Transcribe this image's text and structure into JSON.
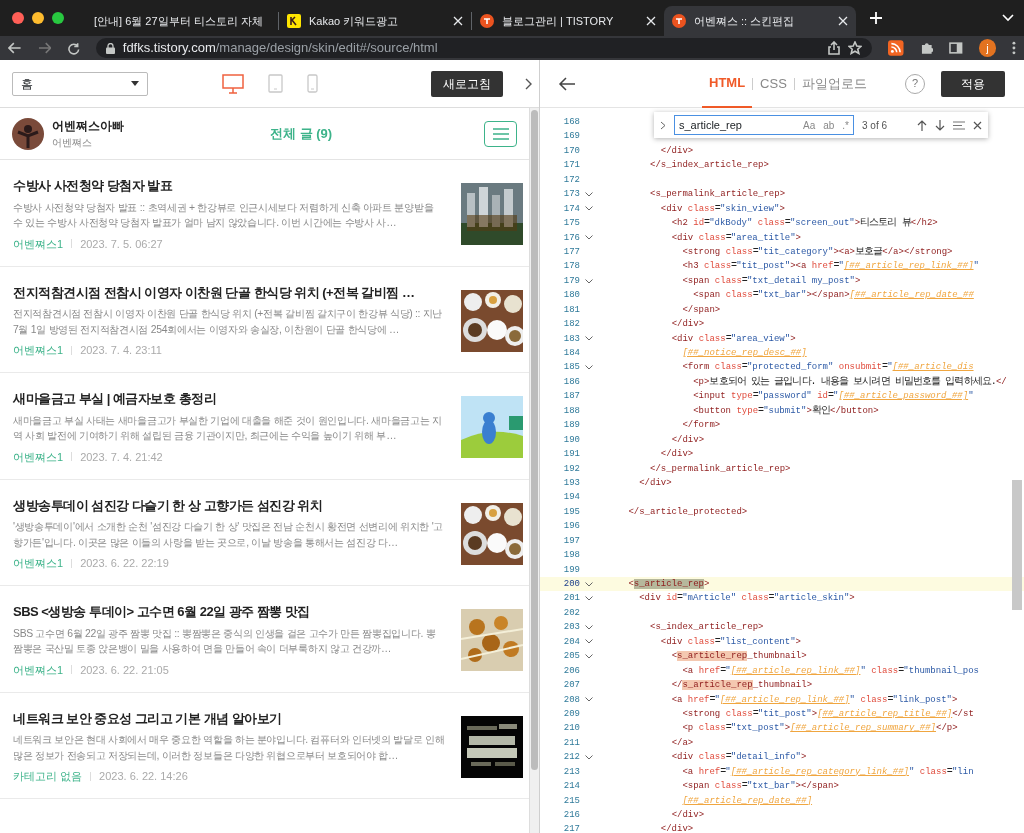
{
  "browser": {
    "tabs": [
      {
        "title": "[안내] 6월 27일부터 티스토리 자체",
        "kind": "none",
        "selected": false
      },
      {
        "title": "Kakao 키워드광고",
        "kind": "kakao",
        "selected": false
      },
      {
        "title": "블로그관리 | TISTORY",
        "kind": "tistory",
        "selected": false
      },
      {
        "title": "어벤쪄스 :: 스킨편집",
        "kind": "tistory",
        "selected": true
      }
    ],
    "url": {
      "host": "fdfks.tistory.com",
      "path": "/manage/design/skin/edit#/source/html"
    },
    "profile_initial": "j"
  },
  "preview": {
    "page_select": "홈",
    "devices": [
      {
        "kind": "desktop",
        "selected": true
      },
      {
        "kind": "tablet",
        "selected": false
      },
      {
        "kind": "mobile",
        "selected": false
      }
    ],
    "refresh_button": "새로고침",
    "blog": {
      "name": "어벤쪄스아빠",
      "subtitle": "어벤쪄스",
      "total": "전체 글 (9)"
    },
    "posts": [
      {
        "title": "수방사 사전청약 당첨자 발표",
        "summary": "수방사 사전청약 당첨자 발표 :: 초역세권 + 한강뷰로 인근시세보다 저렴하게 신축 아파트 분양받을 수 있는 수방사 사전청약 당첨자 발표가 얼마 남지 않았습니다. 이번 시간에는 수방사 사…",
        "category": "어벤쪄스1",
        "date": "2023. 7. 5. 06:27"
      },
      {
        "title": "전지적참견시점 전참시 이영자 이찬원 단골 한식당 위치 (+전복 갈비찜 …",
        "summary": "전지적참견시점 전참시 이영자 이찬원 단골 한식당 위치 (+전복 갈비찜 갈치구이 한강뷰 식당) :: 지난 7월 1일 방영된 전지적참견시점 254회에서는 이영자와 송실장, 이찬원이 단골 한식당에 …",
        "category": "어벤쪄스1",
        "date": "2023. 7. 4. 23:11"
      },
      {
        "title": "새마을금고 부실 | 예금자보호 총정리",
        "summary": "새마을금고 부실 사태는 새마을금고가 부실한 기업에 대출을 해준 것이 원인입니다. 새마을금고는 지역 사회 발전에 기여하기 위해 설립된 금융 기관이지만, 최근에는 수익을 높이기 위해 부…",
        "category": "어벤쪄스1",
        "date": "2023. 7. 4. 21:42"
      },
      {
        "title": "생방송투데이 섬진강 다슬기 한 상 고향가든 섬진강 위치",
        "summary": "'생방송투데이'에서 소개한 순천 '섬진강 다슬기 한 상' 맛집은 전남 순천시 황전면 선변리에 위치한 '고향가든'입니다. 이곳은 많은 이들의 사랑을 받는 곳으로, 이날 방송을 통해서는 섬진강 다…",
        "category": "어벤쪄스1",
        "date": "2023. 6. 22. 22:19"
      },
      {
        "title": "SBS <생방송 투데이> 고수면 6월 22일 광주 짬뽕 맛집",
        "summary": "SBS 고수면 6월 22일 광주 짬뽕 맛집 :: 뽕짬뽕은 중식의 인생을 걸은 고수가 만든 짬뽕집입니다. 뽕짬뽕은 국산밀 토종 앉은뱅이 밀을 사용하여 면을 만들어 속이 더부룩하지 않고 건강까…",
        "category": "어벤쪄스1",
        "date": "2023. 6. 22. 21:05"
      },
      {
        "title": "네트워크 보안 중요성 그리고 기본 개념 알아보기",
        "summary": "네트워크 보안은 현대 사회에서 매우 중요한 역할을 하는 분야입니다. 컴퓨터와 인터넷의 발달로 인해 많은 정보가 전송되고 저장되는데, 이러한 정보들은 다양한 위협으로부터 보호되어야 합…",
        "category": "카테고리 없음",
        "date": "2023. 6. 22. 14:26"
      }
    ]
  },
  "editor": {
    "tabs": [
      {
        "label": "HTML",
        "selected": true
      },
      {
        "label": "CSS",
        "selected": false
      },
      {
        "label": "파일업로드",
        "selected": false
      }
    ],
    "help": "?",
    "apply_button": "적용",
    "find": {
      "value": "s_article_rep",
      "options": [
        "Aa",
        "ab",
        ".*"
      ],
      "count": "3 of 6"
    },
    "lines": [
      {
        "number": "168",
        "fold": false,
        "current": false
      },
      {
        "number": "169",
        "fold": false,
        "current": false
      },
      {
        "number": "170",
        "fold": false,
        "current": false,
        "tokens": [
          {
            "kind": "tag",
            "text": "            </div>"
          }
        ]
      },
      {
        "number": "171",
        "fold": false,
        "current": false,
        "tokens": [
          {
            "kind": "tag",
            "text": "          </s_index_article_rep>"
          }
        ]
      },
      {
        "number": "172",
        "fold": false,
        "current": false
      },
      {
        "number": "173",
        "fold": true,
        "current": false,
        "tokens": [
          {
            "kind": "tag",
            "text": "          <s_permalink_article_rep>"
          }
        ]
      },
      {
        "number": "174",
        "fold": true,
        "current": false,
        "tokens": [
          {
            "kind": "tag",
            "text": "            <div"
          },
          {
            "kind": "attr",
            "text": " class"
          },
          {
            "kind": "text",
            "text": "="
          },
          {
            "kind": "string",
            "text": "\"skin_view\""
          },
          {
            "kind": "tag",
            "text": ">"
          }
        ]
      },
      {
        "number": "175",
        "fold": false,
        "current": false,
        "tokens": [
          {
            "kind": "tag",
            "text": "              <h2"
          },
          {
            "kind": "attr",
            "text": " id"
          },
          {
            "kind": "text",
            "text": "="
          },
          {
            "kind": "string",
            "text": "\"dkBody\""
          },
          {
            "kind": "attr",
            "text": " class"
          },
          {
            "kind": "text",
            "text": "="
          },
          {
            "kind": "string",
            "text": "\"screen_out\""
          },
          {
            "kind": "tag",
            "text": ">"
          },
          {
            "kind": "text",
            "text": "티스토리 뷰"
          },
          {
            "kind": "tag",
            "text": "</h2>"
          }
        ]
      },
      {
        "number": "176",
        "fold": true,
        "current": false,
        "tokens": [
          {
            "kind": "tag",
            "text": "              <div"
          },
          {
            "kind": "attr",
            "text": " class"
          },
          {
            "kind": "text",
            "text": "="
          },
          {
            "kind": "string",
            "text": "\"area_title\""
          },
          {
            "kind": "tag",
            "text": ">"
          }
        ]
      },
      {
        "number": "177",
        "fold": false,
        "current": false,
        "tokens": [
          {
            "kind": "tag",
            "text": "                <strong"
          },
          {
            "kind": "attr",
            "text": " class"
          },
          {
            "kind": "text",
            "text": "="
          },
          {
            "kind": "string",
            "text": "\"tit_category\""
          },
          {
            "kind": "tag",
            "text": "><a>"
          },
          {
            "kind": "text",
            "text": "보호글"
          },
          {
            "kind": "tag",
            "text": "</a></strong>"
          }
        ]
      },
      {
        "number": "178",
        "fold": false,
        "current": false,
        "tokens": [
          {
            "kind": "tag",
            "text": "                <h3"
          },
          {
            "kind": "attr",
            "text": " class"
          },
          {
            "kind": "text",
            "text": "="
          },
          {
            "kind": "string",
            "text": "\"tit_post\""
          },
          {
            "kind": "tag",
            "text": "><a"
          },
          {
            "kind": "attr",
            "text": " href"
          },
          {
            "kind": "text",
            "text": "="
          },
          {
            "kind": "string",
            "text": "\""
          },
          {
            "kind": "template",
            "text": "[##_article_rep_link_##]"
          },
          {
            "kind": "string",
            "text": "\""
          }
        ]
      },
      {
        "number": "179",
        "fold": true,
        "current": false,
        "tokens": [
          {
            "kind": "tag",
            "text": "                <span"
          },
          {
            "kind": "attr",
            "text": " class"
          },
          {
            "kind": "text",
            "text": "="
          },
          {
            "kind": "string",
            "text": "\"txt_detail my_post\""
          },
          {
            "kind": "tag",
            "text": ">"
          }
        ]
      },
      {
        "number": "180",
        "fold": false,
        "current": false,
        "tokens": [
          {
            "kind": "tag",
            "text": "                  <span"
          },
          {
            "kind": "attr",
            "text": " class"
          },
          {
            "kind": "text",
            "text": "="
          },
          {
            "kind": "string",
            "text": "\"txt_bar\""
          },
          {
            "kind": "tag",
            "text": "></span>"
          },
          {
            "kind": "template",
            "text": "[##_article_rep_date_##"
          }
        ]
      },
      {
        "number": "181",
        "fold": false,
        "current": false,
        "tokens": [
          {
            "kind": "tag",
            "text": "                </span>"
          }
        ]
      },
      {
        "number": "182",
        "fold": false,
        "current": false,
        "tokens": [
          {
            "kind": "tag",
            "text": "              </div>"
          }
        ]
      },
      {
        "number": "183",
        "fold": true,
        "current": false,
        "tokens": [
          {
            "kind": "tag",
            "text": "              <div"
          },
          {
            "kind": "attr",
            "text": " class"
          },
          {
            "kind": "text",
            "text": "="
          },
          {
            "kind": "string",
            "text": "\"area_view\""
          },
          {
            "kind": "tag",
            "text": ">"
          }
        ]
      },
      {
        "number": "184",
        "fold": false,
        "current": false,
        "tokens": [
          {
            "kind": "template",
            "text": "                [##_notice_rep_desc_##]"
          }
        ]
      },
      {
        "number": "185",
        "fold": true,
        "current": false,
        "tokens": [
          {
            "kind": "tag",
            "text": "                <form"
          },
          {
            "kind": "attr",
            "text": " class"
          },
          {
            "kind": "text",
            "text": "="
          },
          {
            "kind": "string",
            "text": "\"protected_form\""
          },
          {
            "kind": "attr",
            "text": " onsubmit"
          },
          {
            "kind": "text",
            "text": "="
          },
          {
            "kind": "string",
            "text": "\""
          },
          {
            "kind": "template",
            "text": "[##_article_dis"
          }
        ]
      },
      {
        "number": "186",
        "fold": false,
        "current": false,
        "tokens": [
          {
            "kind": "tag",
            "text": "                  <p>"
          },
          {
            "kind": "text",
            "text": "보호되어 있는 글입니다. 내용을 보시려면 비밀번호를 입력하세요."
          },
          {
            "kind": "tag",
            "text": "</"
          }
        ]
      },
      {
        "number": "187",
        "fold": false,
        "current": false,
        "tokens": [
          {
            "kind": "tag",
            "text": "                  <input"
          },
          {
            "kind": "attr",
            "text": " type"
          },
          {
            "kind": "text",
            "text": "="
          },
          {
            "kind": "string",
            "text": "\"password\""
          },
          {
            "kind": "attr",
            "text": " id"
          },
          {
            "kind": "text",
            "text": "="
          },
          {
            "kind": "string",
            "text": "\""
          },
          {
            "kind": "template",
            "text": "[##_article_password_##]"
          },
          {
            "kind": "string",
            "text": "\""
          }
        ]
      },
      {
        "number": "188",
        "fold": false,
        "current": false,
        "tokens": [
          {
            "kind": "tag",
            "text": "                  <button"
          },
          {
            "kind": "attr",
            "text": " type"
          },
          {
            "kind": "text",
            "text": "="
          },
          {
            "kind": "string",
            "text": "\"submit\""
          },
          {
            "kind": "tag",
            "text": ">"
          },
          {
            "kind": "text",
            "text": "확인"
          },
          {
            "kind": "tag",
            "text": "</button>"
          }
        ]
      },
      {
        "number": "189",
        "fold": false,
        "current": false,
        "tokens": [
          {
            "kind": "tag",
            "text": "                </form>"
          }
        ]
      },
      {
        "number": "190",
        "fold": false,
        "current": false,
        "tokens": [
          {
            "kind": "tag",
            "text": "              </div>"
          }
        ]
      },
      {
        "number": "191",
        "fold": false,
        "current": false,
        "tokens": [
          {
            "kind": "tag",
            "text": "            </div>"
          }
        ]
      },
      {
        "number": "192",
        "fold": false,
        "current": false,
        "tokens": [
          {
            "kind": "tag",
            "text": "          </s_permalink_article_rep>"
          }
        ]
      },
      {
        "number": "193",
        "fold": false,
        "current": false,
        "tokens": [
          {
            "kind": "tag",
            "text": "        </div>"
          }
        ]
      },
      {
        "number": "194",
        "fold": false,
        "current": false
      },
      {
        "number": "195",
        "fold": false,
        "current": false,
        "tokens": [
          {
            "kind": "tag",
            "text": "      </s_article_protected>"
          }
        ]
      },
      {
        "number": "196",
        "fold": false,
        "current": false
      },
      {
        "number": "197",
        "fold": false,
        "current": false
      },
      {
        "number": "198",
        "fold": false,
        "current": false
      },
      {
        "number": "199",
        "fold": false,
        "current": false
      },
      {
        "number": "200",
        "fold": true,
        "current": true,
        "tokens": [
          {
            "kind": "tag",
            "text": "      <"
          },
          {
            "kind": "current_match",
            "text": "s_article_rep"
          },
          {
            "kind": "tag",
            "text": ">"
          }
        ]
      },
      {
        "number": "201",
        "fold": true,
        "current": false,
        "tokens": [
          {
            "kind": "tag",
            "text": "        <div"
          },
          {
            "kind": "attr",
            "text": " id"
          },
          {
            "kind": "text",
            "text": "="
          },
          {
            "kind": "string",
            "text": "\"mArticle\""
          },
          {
            "kind": "attr",
            "text": " class"
          },
          {
            "kind": "text",
            "text": "="
          },
          {
            "kind": "string",
            "text": "\"article_skin\""
          },
          {
            "kind": "tag",
            "text": ">"
          }
        ]
      },
      {
        "number": "202",
        "fold": false,
        "current": false
      },
      {
        "number": "203",
        "fold": true,
        "current": false,
        "tokens": [
          {
            "kind": "tag",
            "text": "          <s_index_article_rep>"
          }
        ]
      },
      {
        "number": "204",
        "fold": true,
        "current": false,
        "tokens": [
          {
            "kind": "tag",
            "text": "            <div"
          },
          {
            "kind": "attr",
            "text": " class"
          },
          {
            "kind": "text",
            "text": "="
          },
          {
            "kind": "string",
            "text": "\"list_content\""
          },
          {
            "kind": "tag",
            "text": ">"
          }
        ]
      },
      {
        "number": "205",
        "fold": true,
        "current": false,
        "tokens": [
          {
            "kind": "tag",
            "text": "              <"
          },
          {
            "kind": "match",
            "text": "s_article_rep"
          },
          {
            "kind": "tag",
            "text": "_thumbnail>"
          }
        ]
      },
      {
        "number": "206",
        "fold": false,
        "current": false,
        "tokens": [
          {
            "kind": "tag",
            "text": "                <a"
          },
          {
            "kind": "attr",
            "text": " href"
          },
          {
            "kind": "text",
            "text": "="
          },
          {
            "kind": "string",
            "text": "\""
          },
          {
            "kind": "template",
            "text": "[##_article_rep_link_##]"
          },
          {
            "kind": "string",
            "text": "\""
          },
          {
            "kind": "attr",
            "text": " class"
          },
          {
            "kind": "text",
            "text": "="
          },
          {
            "kind": "string",
            "text": "\"thumbnail_pos"
          }
        ]
      },
      {
        "number": "207",
        "fold": false,
        "current": false,
        "tokens": [
          {
            "kind": "tag",
            "text": "              </"
          },
          {
            "kind": "match",
            "text": "s_article_rep"
          },
          {
            "kind": "tag",
            "text": "_thumbnail>"
          }
        ]
      },
      {
        "number": "208",
        "fold": true,
        "current": false,
        "tokens": [
          {
            "kind": "tag",
            "text": "              <a"
          },
          {
            "kind": "attr",
            "text": " href"
          },
          {
            "kind": "text",
            "text": "="
          },
          {
            "kind": "string",
            "text": "\""
          },
          {
            "kind": "template",
            "text": "[##_article_rep_link_##]"
          },
          {
            "kind": "string",
            "text": "\""
          },
          {
            "kind": "attr",
            "text": " class"
          },
          {
            "kind": "text",
            "text": "="
          },
          {
            "kind": "string",
            "text": "\"link_post\""
          },
          {
            "kind": "tag",
            "text": ">"
          }
        ]
      },
      {
        "number": "209",
        "fold": false,
        "current": false,
        "tokens": [
          {
            "kind": "tag",
            "text": "                <strong"
          },
          {
            "kind": "attr",
            "text": " class"
          },
          {
            "kind": "text",
            "text": "="
          },
          {
            "kind": "string",
            "text": "\"tit_post\""
          },
          {
            "kind": "tag",
            "text": ">"
          },
          {
            "kind": "template",
            "text": "[##_article_rep_title_##]"
          },
          {
            "kind": "tag",
            "text": "</st"
          }
        ]
      },
      {
        "number": "210",
        "fold": false,
        "current": false,
        "tokens": [
          {
            "kind": "tag",
            "text": "                <p"
          },
          {
            "kind": "attr",
            "text": " class"
          },
          {
            "kind": "text",
            "text": "="
          },
          {
            "kind": "string",
            "text": "\"txt_post\""
          },
          {
            "kind": "tag",
            "text": ">"
          },
          {
            "kind": "template",
            "text": "[##_article_rep_summary_##]"
          },
          {
            "kind": "tag",
            "text": "</p>"
          }
        ]
      },
      {
        "number": "211",
        "fold": false,
        "current": false,
        "tokens": [
          {
            "kind": "tag",
            "text": "              </a>"
          }
        ]
      },
      {
        "number": "212",
        "fold": true,
        "current": false,
        "tokens": [
          {
            "kind": "tag",
            "text": "              <div"
          },
          {
            "kind": "attr",
            "text": " class"
          },
          {
            "kind": "text",
            "text": "="
          },
          {
            "kind": "string",
            "text": "\"detail_info\""
          },
          {
            "kind": "tag",
            "text": ">"
          }
        ]
      },
      {
        "number": "213",
        "fold": false,
        "current": false,
        "tokens": [
          {
            "kind": "tag",
            "text": "                <a"
          },
          {
            "kind": "attr",
            "text": " href"
          },
          {
            "kind": "text",
            "text": "="
          },
          {
            "kind": "string",
            "text": "\""
          },
          {
            "kind": "template",
            "text": "[##_article_rep_category_link_##]"
          },
          {
            "kind": "string",
            "text": "\""
          },
          {
            "kind": "attr",
            "text": " class"
          },
          {
            "kind": "text",
            "text": "="
          },
          {
            "kind": "string",
            "text": "\"lin"
          }
        ]
      },
      {
        "number": "214",
        "fold": false,
        "current": false,
        "tokens": [
          {
            "kind": "tag",
            "text": "                <span"
          },
          {
            "kind": "attr",
            "text": " class"
          },
          {
            "kind": "text",
            "text": "="
          },
          {
            "kind": "string",
            "text": "\"txt_bar\""
          },
          {
            "kind": "tag",
            "text": "></span>"
          }
        ]
      },
      {
        "number": "215",
        "fold": false,
        "current": false,
        "tokens": [
          {
            "kind": "template",
            "text": "                [##_article_rep_date_##]"
          }
        ]
      },
      {
        "number": "216",
        "fold": false,
        "current": false,
        "tokens": [
          {
            "kind": "tag",
            "text": "              </div>"
          }
        ]
      },
      {
        "number": "217",
        "fold": false,
        "current": false,
        "tokens": [
          {
            "kind": "tag",
            "text": "            </div>"
          }
        ]
      }
    ]
  }
}
